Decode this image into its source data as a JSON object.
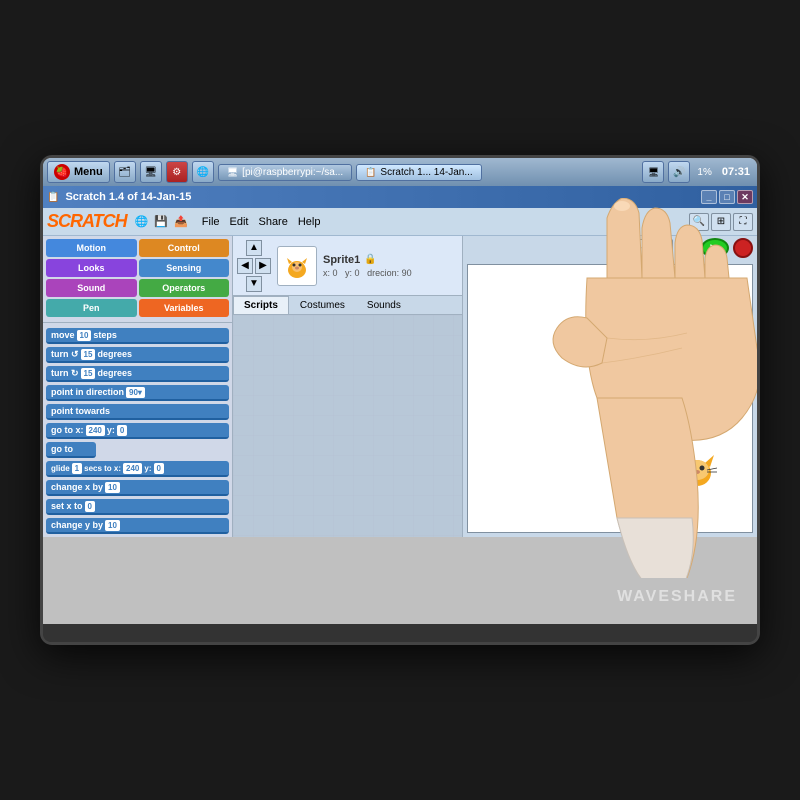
{
  "monitor": {
    "title": "Scratch 1.4 of 14-Jan-15"
  },
  "taskbar": {
    "menu_label": "Menu",
    "window1_label": "[pi@raspberrypi:~/sa...",
    "window2_label": "Scratch 1... 14-Jan...",
    "battery": "1%",
    "time": "07:31"
  },
  "scratch": {
    "title": "Scratch 1.4 of 14-Jan-15",
    "menu_items": [
      "File",
      "Edit",
      "Share",
      "Help"
    ],
    "logo": "SCRATCH",
    "categories": [
      {
        "label": "Motion",
        "color": "#4488dd"
      },
      {
        "label": "Control",
        "color": "#dd8822"
      },
      {
        "label": "Looks",
        "color": "#8844dd"
      },
      {
        "label": "Sensing",
        "color": "#4488cc"
      },
      {
        "label": "Sound",
        "color": "#aa44bb"
      },
      {
        "label": "Operators",
        "color": "#44aa44"
      },
      {
        "label": "Pen",
        "color": "#44aaaa"
      },
      {
        "label": "Variables",
        "color": "#ee6622"
      }
    ],
    "blocks": [
      "move 10 steps",
      "turn ↺ 15 degrees",
      "turn ↻ 15 degrees",
      "point in direction 90▾",
      "point towards",
      "go to x: 240 y: 0",
      "go to",
      "glide 1 secs to x: 240 y: 0",
      "change x by 10",
      "set x to 0",
      "change y by 10"
    ],
    "sprite": {
      "name": "Sprite1",
      "x": "0",
      "y": "0",
      "direction": "90"
    },
    "tabs": [
      "Scripts",
      "Costumes",
      "Sounds"
    ]
  },
  "watermark": "WAVESHARE"
}
